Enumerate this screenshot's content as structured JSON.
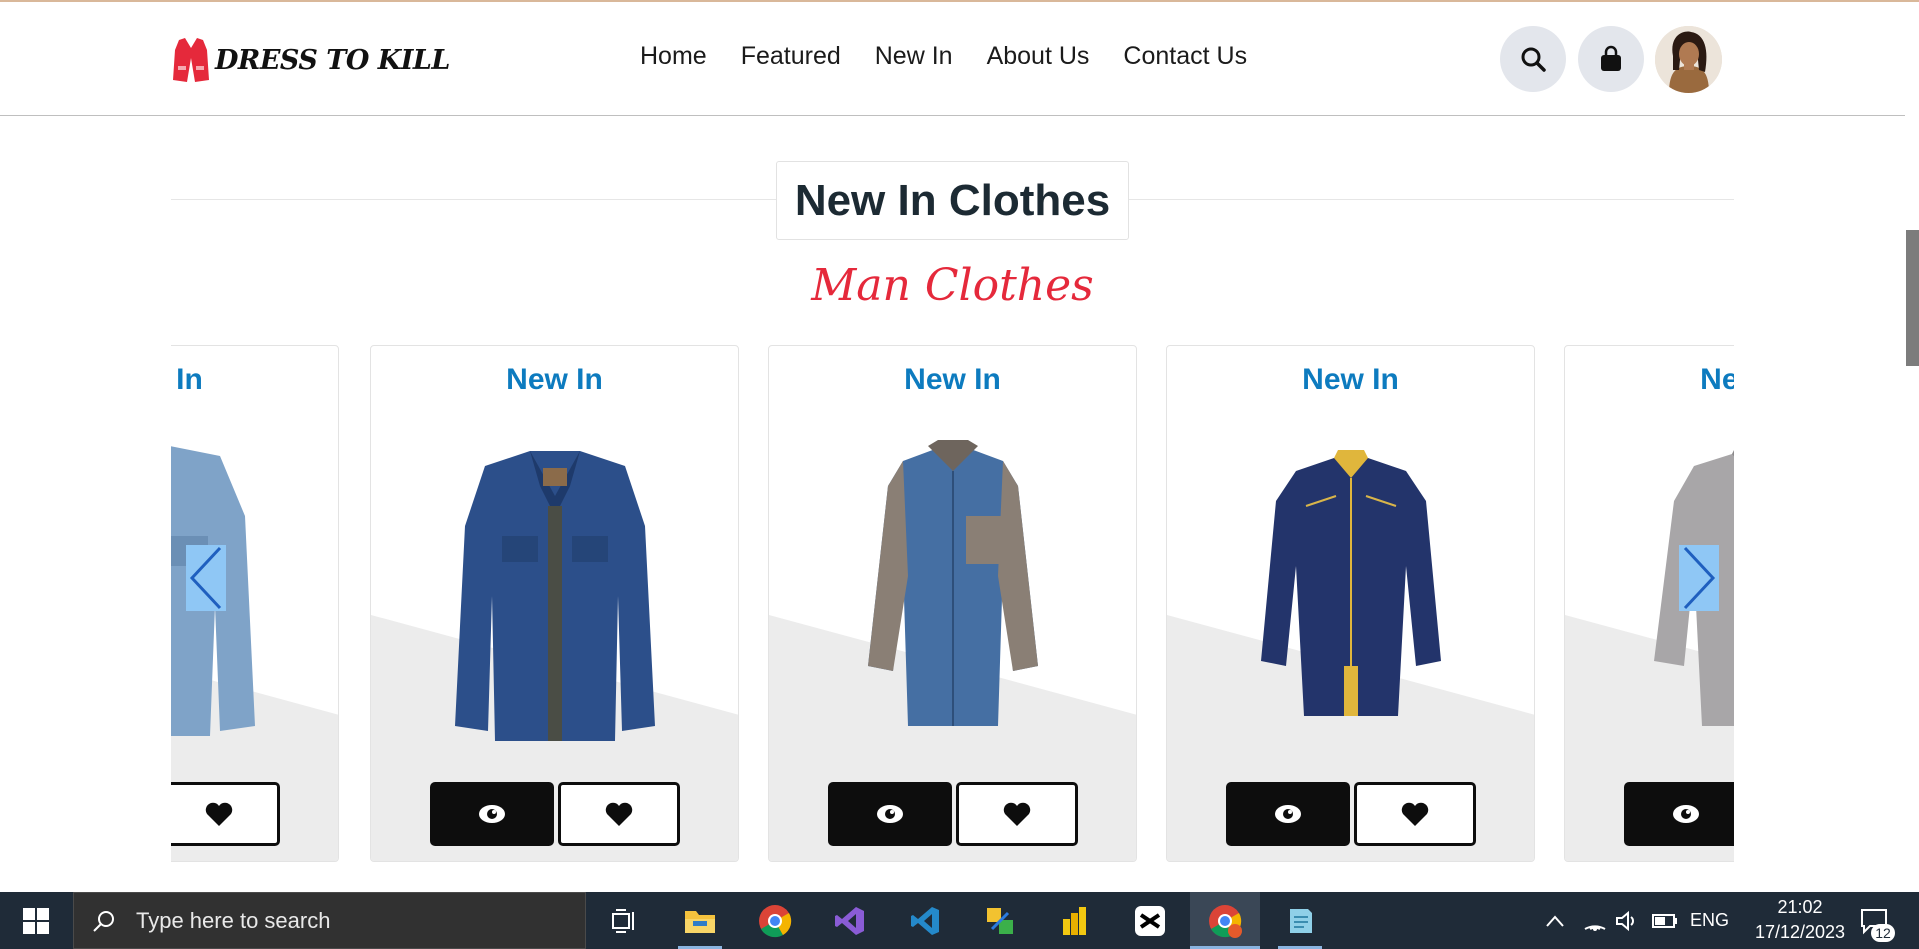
{
  "brand": {
    "name": "DRESS TO KILL",
    "accent_color": "#e5293b"
  },
  "nav": {
    "items": [
      {
        "label": "Home"
      },
      {
        "label": "Featured"
      },
      {
        "label": "New In"
      },
      {
        "label": "About Us"
      },
      {
        "label": "Contact Us"
      }
    ]
  },
  "header_icons": [
    "search-icon",
    "shopping-bag-icon",
    "avatar"
  ],
  "section": {
    "title": "New In Clothes",
    "subtitle": "Man Clothes"
  },
  "products": [
    {
      "badge": "New In",
      "image": "light-denim-jacket"
    },
    {
      "badge": "New In",
      "image": "dark-denim-jacket"
    },
    {
      "badge": "New In",
      "image": "blue-grey-shirt"
    },
    {
      "badge": "New In",
      "image": "navy-shirt"
    },
    {
      "badge": "New In",
      "image": "grey-shirt"
    }
  ],
  "product_badge_color": "#0d7bbf",
  "taskbar": {
    "search_placeholder": "Type here to search",
    "language": "ENG",
    "time": "21:02",
    "date": "17/12/2023",
    "notification_count": "12",
    "apps": [
      "task-view-icon",
      "file-explorer-icon",
      "chrome-icon",
      "visual-studio-icon",
      "vscode-icon",
      "app-icon",
      "power-bi-icon",
      "capcut-icon",
      "chrome-active-icon",
      "notepad-icon"
    ]
  }
}
